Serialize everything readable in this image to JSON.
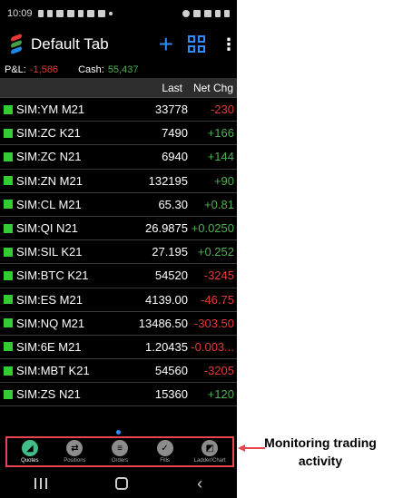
{
  "status_bar": {
    "time": "10:09"
  },
  "app_bar": {
    "title": "Default Tab",
    "add_label": "+",
    "more_label": "⋮"
  },
  "account": {
    "pl_label": "P&L:",
    "pl_value": "-1,586",
    "cash_label": "Cash:",
    "cash_value": "55,437"
  },
  "table": {
    "headers": {
      "last": "Last",
      "net_chg": "Net Chg"
    },
    "rows": [
      {
        "symbol": "SIM:YM M21",
        "last": "33778",
        "net_chg": "-230",
        "direction": "down"
      },
      {
        "symbol": "SIM:ZC K21",
        "last": "7490",
        "net_chg": "+166",
        "direction": "up"
      },
      {
        "symbol": "SIM:ZC N21",
        "last": "6940",
        "net_chg": "+144",
        "direction": "up"
      },
      {
        "symbol": "SIM:ZN M21",
        "last": "132195",
        "net_chg": "+90",
        "direction": "up"
      },
      {
        "symbol": "SIM:CL M21",
        "last": "65.30",
        "net_chg": "+0.81",
        "direction": "up"
      },
      {
        "symbol": "SIM:QI N21",
        "last": "26.9875",
        "net_chg": "+0.0250",
        "direction": "up"
      },
      {
        "symbol": "SIM:SIL K21",
        "last": "27.195",
        "net_chg": "+0.252",
        "direction": "up"
      },
      {
        "symbol": "SIM:BTC K21",
        "last": "54520",
        "net_chg": "-3245",
        "direction": "down"
      },
      {
        "symbol": "SIM:ES M21",
        "last": "4139.00",
        "net_chg": "-46.75",
        "direction": "down"
      },
      {
        "symbol": "SIM:NQ M21",
        "last": "13486.50",
        "net_chg": "-303.50",
        "direction": "down"
      },
      {
        "symbol": "SIM:6E M21",
        "last": "1.20435",
        "net_chg": "-0.003...",
        "direction": "down"
      },
      {
        "symbol": "SIM:MBT K21",
        "last": "54560",
        "net_chg": "-3205",
        "direction": "down"
      },
      {
        "symbol": "SIM:ZS N21",
        "last": "15360",
        "net_chg": "+120",
        "direction": "up"
      }
    ]
  },
  "bottom_nav": {
    "items": [
      {
        "label": "Quotes",
        "icon": "quotes-icon",
        "active": true
      },
      {
        "label": "Positions",
        "icon": "positions-icon",
        "active": false
      },
      {
        "label": "Orders",
        "icon": "orders-icon",
        "active": false
      },
      {
        "label": "Fills",
        "icon": "fills-icon",
        "active": false
      },
      {
        "label": "Ladder/Chart",
        "icon": "ladder-chart-icon",
        "active": false
      }
    ]
  },
  "annotation": {
    "text": "Monitoring trading activity"
  },
  "colors": {
    "up": "#4caf50",
    "down": "#e53935",
    "accent": "#2f8cff",
    "highlight": "#e8434f"
  }
}
